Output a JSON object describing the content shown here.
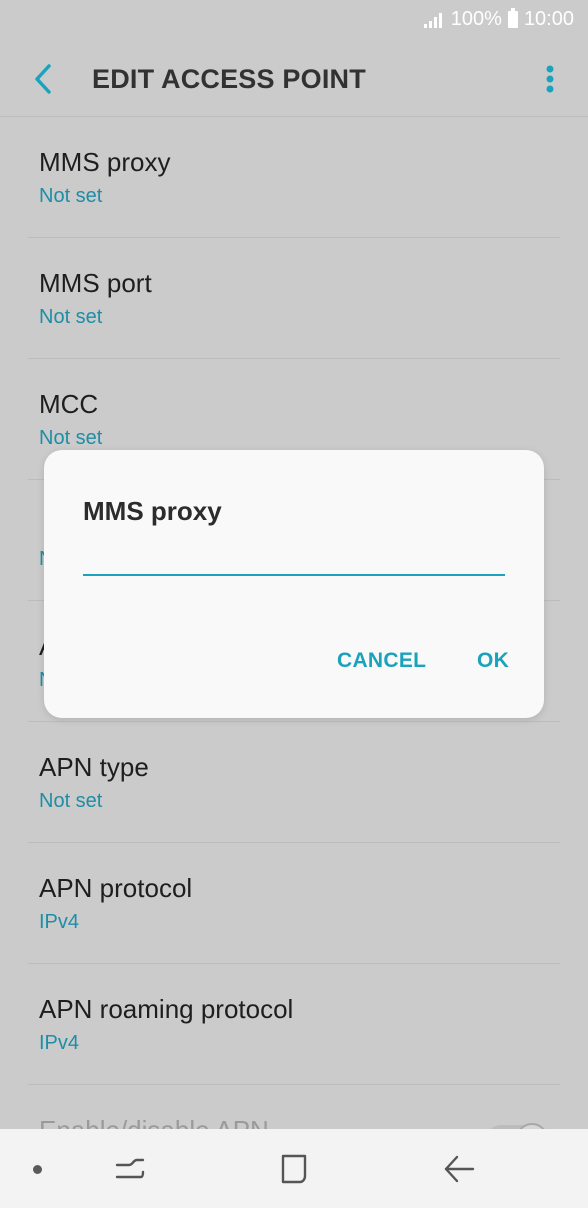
{
  "status_bar": {
    "battery": "100%",
    "time": "10:00"
  },
  "app_bar": {
    "title": "EDIT ACCESS POINT",
    "icons": {
      "back": "back-arrow-icon",
      "more": "more-vert-icon"
    }
  },
  "settings": [
    {
      "label": "MMS proxy",
      "value": "Not set"
    },
    {
      "label": "MMS port",
      "value": "Not set"
    },
    {
      "label": "MCC",
      "value": "Not set"
    },
    {
      "label": "",
      "value": ""
    },
    {
      "label": "",
      "value": ""
    },
    {
      "label": "APN type",
      "value": "Not set"
    },
    {
      "label": "APN protocol",
      "value": "IPv4"
    },
    {
      "label": "APN roaming protocol",
      "value": "IPv4"
    },
    {
      "label": "Enable/disable APN",
      "value": ""
    }
  ],
  "partial_initials": [
    "N",
    "A",
    "N"
  ],
  "dialog": {
    "title": "MMS proxy",
    "input_value": "",
    "cancel_label": "CANCEL",
    "ok_label": "OK"
  },
  "nav_bar": {
    "icons": [
      "dot-icon",
      "recents-icon",
      "home-icon",
      "back-icon"
    ]
  },
  "colors": {
    "accent": "#1ba2bd",
    "value_text": "#1e8ea6",
    "dim_background": "#cbcbcb",
    "dialog_background": "#f9f9f9"
  }
}
